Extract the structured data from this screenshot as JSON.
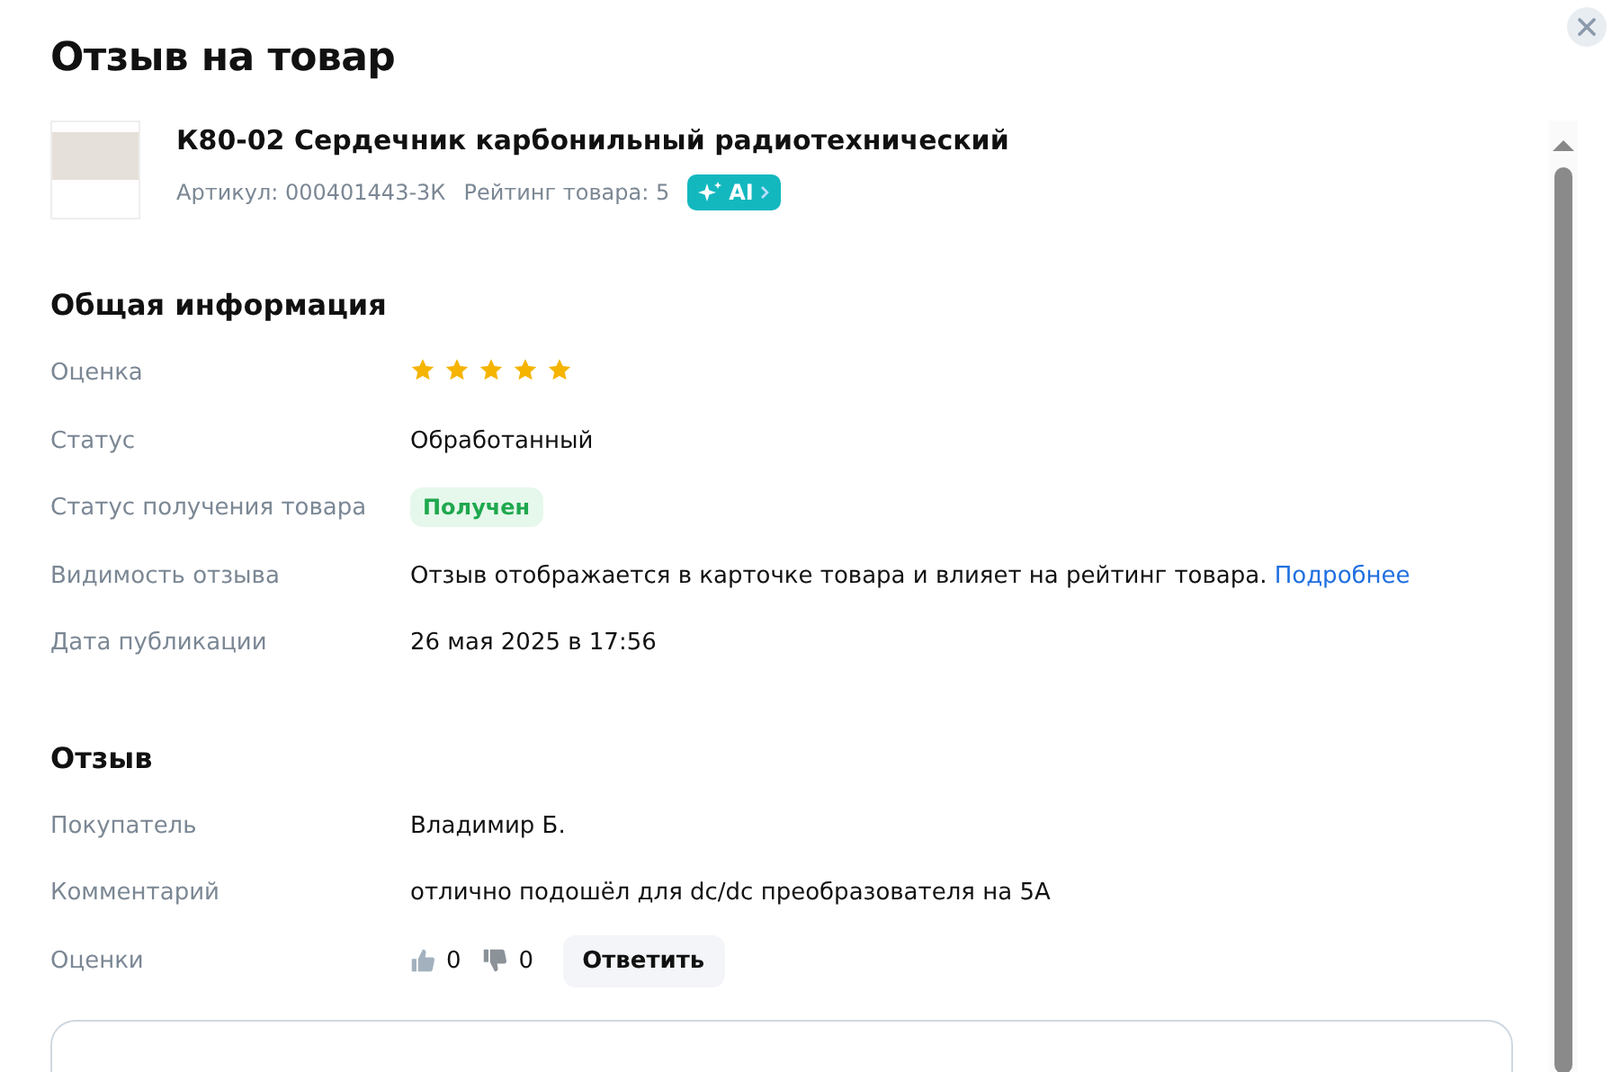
{
  "title": "Отзыв на товар",
  "product": {
    "name": "К80-02 Сердечник карбонильный радиотехнический",
    "article": "Артикул: 000401443-3К",
    "rating": "Рейтинг товара: 5",
    "ai_badge": "AI"
  },
  "sections": [
    {
      "heading": "Общая информация",
      "rows": [
        {
          "kind": "stars",
          "label": "Оценка",
          "stars": 5
        },
        {
          "kind": "text",
          "label": "Статус",
          "value": "Обработанный"
        },
        {
          "kind": "badge",
          "label": "Статус получения товара",
          "value": "Получен"
        },
        {
          "kind": "link_text",
          "label": "Видимость отзыва",
          "value": "Отзыв отображается в карточке товара и влияет на рейтинг товара.",
          "link": "Подробнее"
        },
        {
          "kind": "text",
          "label": "Дата публикации",
          "value": "26 мая 2025 в 17:56"
        }
      ]
    },
    {
      "heading": "Отзыв",
      "rows": [
        {
          "kind": "text",
          "label": "Покупатель",
          "value": "Владимир Б."
        },
        {
          "kind": "text",
          "label": "Комментарий",
          "value": "отлично подошёл для dc/dc преобразователя на 5А"
        },
        {
          "kind": "votes",
          "label": "Оценки",
          "likes": "0",
          "dislikes": "0",
          "reply_button": "Ответить"
        }
      ]
    }
  ]
}
